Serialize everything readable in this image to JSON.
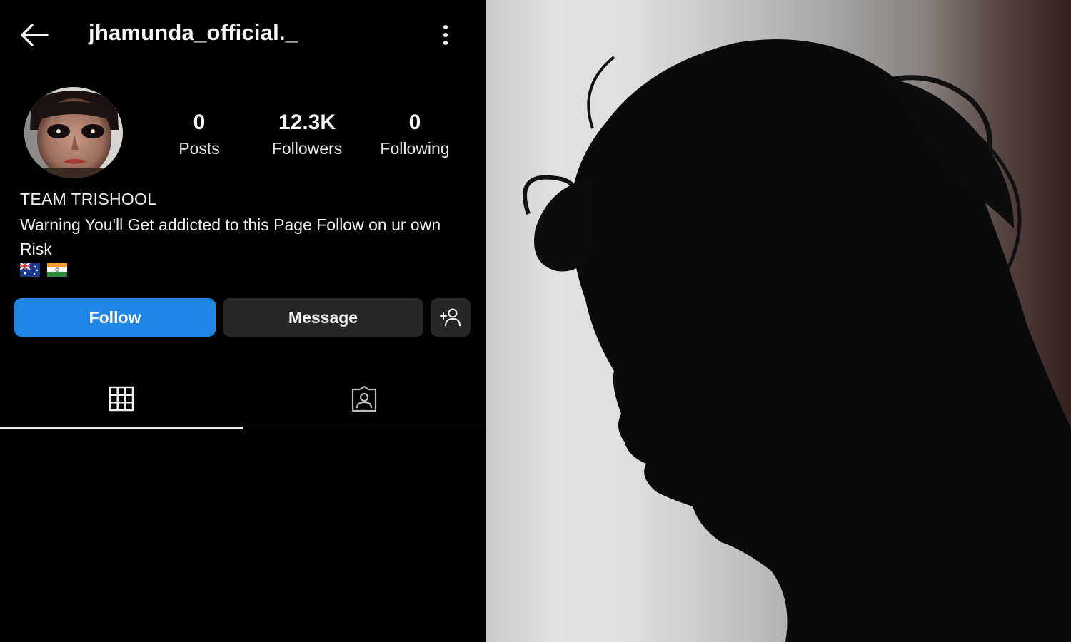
{
  "profile": {
    "username": "jhamunda_official._",
    "stats": {
      "posts_value": "0",
      "posts_label": "Posts",
      "followers_value": "12.3K",
      "followers_label": "Followers",
      "following_value": "0",
      "following_label": "Following"
    },
    "bio": {
      "name": "TEAM TRISHOOL",
      "text": "Warning You'll Get addicted to this Page Follow on ur own Risk",
      "flags": [
        "australia-flag",
        "india-flag"
      ]
    },
    "actions": {
      "follow_label": "Follow",
      "message_label": "Message",
      "add_user_icon": "add-user-icon"
    },
    "tabs": [
      {
        "icon": "grid-icon",
        "active": true
      },
      {
        "icon": "tagged-icon",
        "active": false
      }
    ]
  },
  "header": {
    "back_icon": "back-arrow-icon",
    "more_icon": "more-vertical-icon"
  },
  "colors": {
    "background": "#000000",
    "follow_button": "#1e86e4",
    "secondary_button": "#272727",
    "text": "#f5f5f5"
  },
  "photo": {
    "subject": "silhouette-photo"
  }
}
